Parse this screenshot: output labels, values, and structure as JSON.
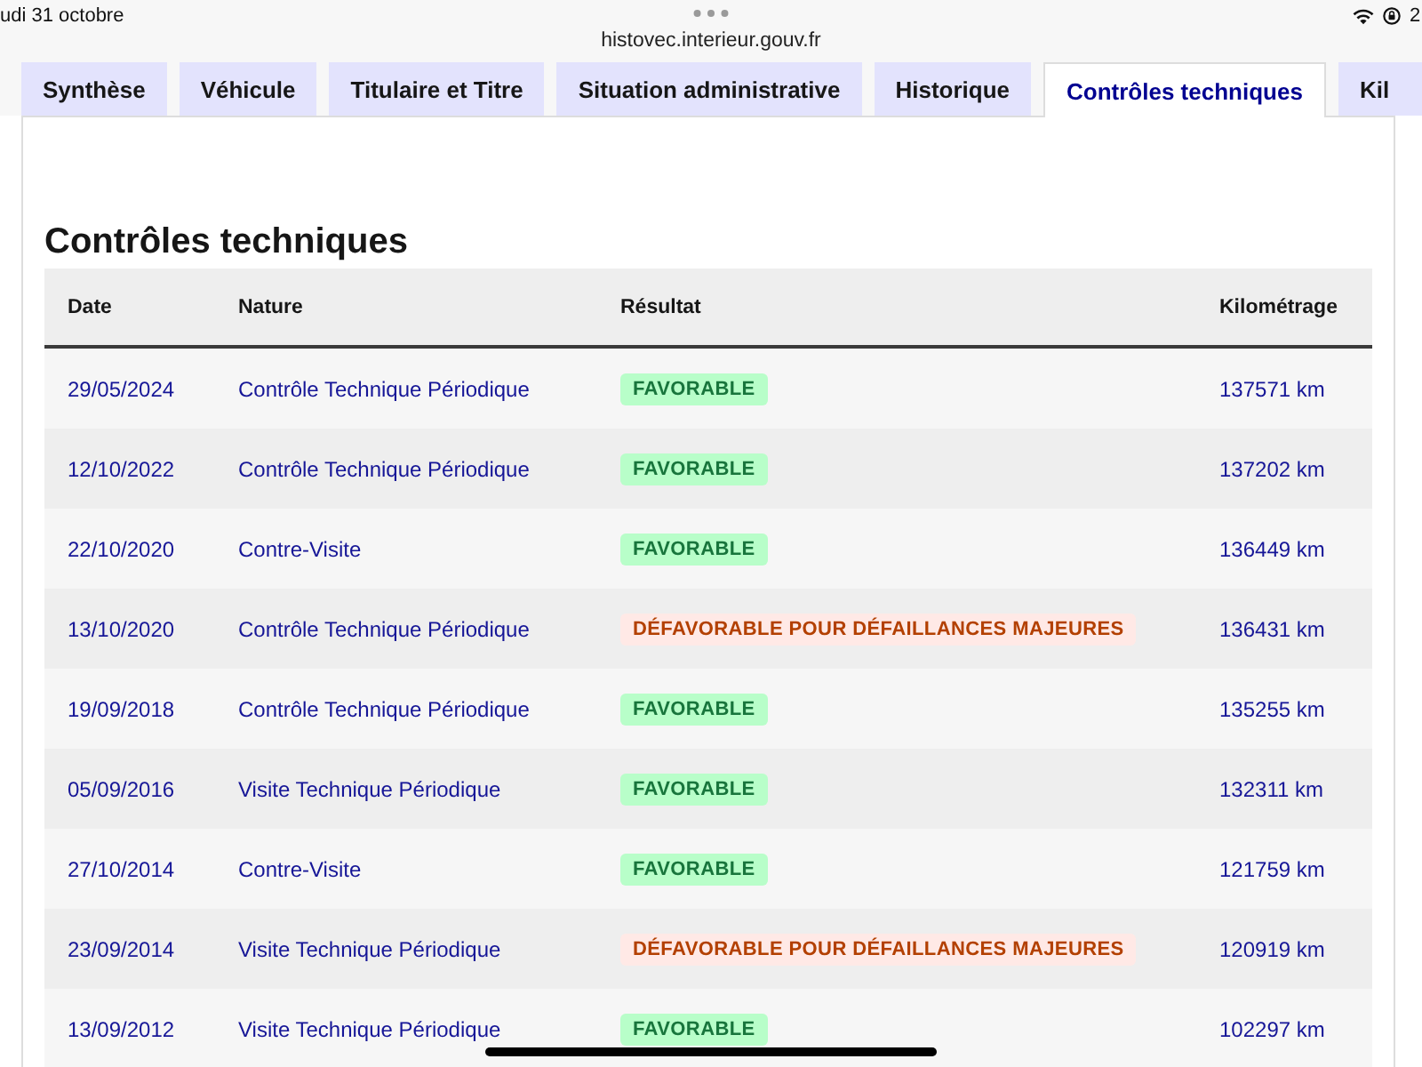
{
  "status_bar": {
    "date": "udi 31 octobre",
    "url": "histovec.interieur.gouv.fr",
    "battery": "2"
  },
  "tabs": [
    {
      "label": "Synthèse",
      "selected": false
    },
    {
      "label": "Véhicule",
      "selected": false
    },
    {
      "label": "Titulaire et Titre",
      "selected": false
    },
    {
      "label": "Situation administrative",
      "selected": false
    },
    {
      "label": "Historique",
      "selected": false
    },
    {
      "label": "Contrôles techniques",
      "selected": true
    },
    {
      "label": "Kil",
      "selected": false
    }
  ],
  "section": {
    "title": "Contrôles techniques"
  },
  "table": {
    "columns": [
      "Date",
      "Nature",
      "Résultat",
      "Kilométrage"
    ],
    "rows": [
      {
        "date": "29/05/2024",
        "nature": "Contrôle Technique Périodique",
        "result": {
          "text": "FAVORABLE",
          "kind": "success"
        },
        "mileage": "137571 km"
      },
      {
        "date": "12/10/2022",
        "nature": "Contrôle Technique Périodique",
        "result": {
          "text": "FAVORABLE",
          "kind": "success"
        },
        "mileage": "137202 km"
      },
      {
        "date": "22/10/2020",
        "nature": "Contre-Visite",
        "result": {
          "text": "FAVORABLE",
          "kind": "success"
        },
        "mileage": "136449 km"
      },
      {
        "date": "13/10/2020",
        "nature": "Contrôle Technique Périodique",
        "result": {
          "text": "DÉFAVORABLE POUR DÉFAILLANCES MAJEURES",
          "kind": "error"
        },
        "mileage": "136431 km"
      },
      {
        "date": "19/09/2018",
        "nature": "Contrôle Technique Périodique",
        "result": {
          "text": "FAVORABLE",
          "kind": "success"
        },
        "mileage": "135255 km"
      },
      {
        "date": "05/09/2016",
        "nature": "Visite Technique Périodique",
        "result": {
          "text": "FAVORABLE",
          "kind": "success"
        },
        "mileage": "132311 km"
      },
      {
        "date": "27/10/2014",
        "nature": "Contre-Visite",
        "result": {
          "text": "FAVORABLE",
          "kind": "success"
        },
        "mileage": "121759 km"
      },
      {
        "date": "23/09/2014",
        "nature": "Visite Technique Périodique",
        "result": {
          "text": "DÉFAVORABLE POUR DÉFAILLANCES MAJEURES",
          "kind": "error"
        },
        "mileage": "120919 km"
      },
      {
        "date": "13/09/2012",
        "nature": "Visite Technique Périodique",
        "result": {
          "text": "FAVORABLE",
          "kind": "success"
        },
        "mileage": "102297 km"
      }
    ]
  }
}
